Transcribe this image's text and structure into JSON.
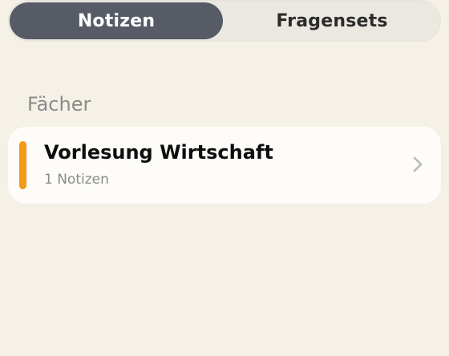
{
  "tabs": {
    "notes_label": "Notizen",
    "sets_label": "Fragensets",
    "selected": "Notizen"
  },
  "section": {
    "title": "Fächer"
  },
  "subjects": [
    {
      "title": "Vorlesung Wirtschaft",
      "subtitle": "1 Notizen",
      "accent_color": "#f39a17",
      "chevron_icon": "chevron-right-icon"
    }
  ],
  "colors": {
    "background": "#f5f1e7",
    "segment_active": "#565b66",
    "accent": "#f39a17"
  }
}
